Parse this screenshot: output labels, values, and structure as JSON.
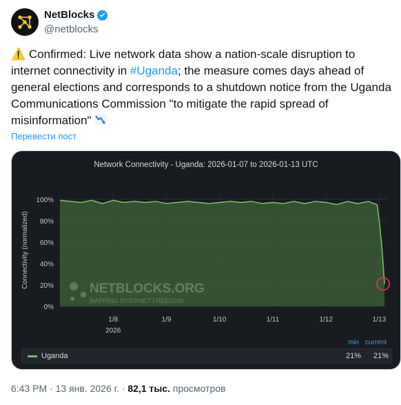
{
  "author": {
    "display_name": "NetBlocks",
    "handle": "@netblocks",
    "avatar_icon": "netblocks-logo-icon",
    "verified_icon": "verified-badge-icon"
  },
  "tweet": {
    "warning_emoji": "⚠️",
    "text_part1": " Confirmed: Live network data show a nation-scale disruption to internet connectivity in ",
    "hashtag": "#Uganda",
    "text_part2": "; the measure comes days ahead of general elections and corresponds to a shutdown notice from the Uganda Communications Commission \"to mitigate the rapid spread of misinformation\" ",
    "trend_emoji_icon": "chart-decreasing-icon",
    "translate_label": "Перевести пост"
  },
  "chart_data": {
    "type": "area",
    "title": "Network Connectivity - Uganda: 2026-01-07 to 2026-01-13 UTC",
    "ylabel": "Connectivity (normalized)",
    "xlabel": "",
    "x_tick_labels": [
      "1/8",
      "1/9",
      "1/10",
      "1/11",
      "1/12",
      "1/13"
    ],
    "x_year_label": "2026",
    "y_tick_labels": [
      "100%",
      "80%",
      "60%",
      "40%",
      "20%",
      "0%"
    ],
    "ylim": [
      0,
      105
    ],
    "x_range": [
      0,
      6.15
    ],
    "x": [
      0.0,
      0.2,
      0.4,
      0.6,
      0.8,
      1.0,
      1.2,
      1.4,
      1.6,
      1.8,
      2.0,
      2.2,
      2.4,
      2.6,
      2.8,
      3.0,
      3.2,
      3.4,
      3.6,
      3.8,
      4.0,
      4.2,
      4.4,
      4.6,
      4.8,
      5.0,
      5.2,
      5.4,
      5.6,
      5.7,
      5.8,
      5.9,
      5.96,
      6.0,
      6.05,
      6.1
    ],
    "series": [
      {
        "name": "Uganda",
        "color": "#73bf69",
        "values": [
          99,
          98,
          97,
          99,
          96,
          99,
          97,
          98,
          97,
          98,
          96,
          97,
          98,
          97,
          96,
          97,
          98,
          97,
          98,
          96,
          97,
          96,
          98,
          96,
          98,
          97,
          95,
          98,
          96,
          97,
          98,
          96,
          95,
          80,
          55,
          21
        ]
      }
    ],
    "legend": {
      "placement": "bottom",
      "min_header": "min",
      "current_header": "current",
      "min_value": "21%",
      "current_value": "21%"
    },
    "annotation": "red circle marking current drop",
    "grid": true,
    "watermark_brand": "NETBLOCKS.ORG",
    "watermark_tagline": "MAPPING INTERNET FREEDOM"
  },
  "meta": {
    "time": "6:43 PM",
    "sep1": " · ",
    "date": "13 янв. 2026 г.",
    "sep2": " · ",
    "views_count": "82,1 тыс.",
    "views_label": " просмотров"
  }
}
